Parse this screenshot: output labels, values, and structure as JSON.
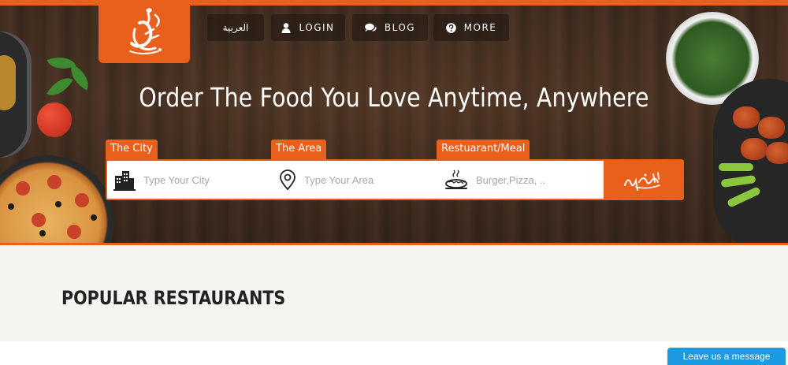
{
  "logo": {
    "alt": "brand-logo"
  },
  "nav": {
    "arabic_label": "العربية",
    "login_label": "LOGIN",
    "blog_label": "BLOG",
    "more_label": "MORE"
  },
  "hero": {
    "title": "Order The Food You Love Anytime, Anywhere"
  },
  "search": {
    "city_label": "The City",
    "city_placeholder": "Type Your City",
    "area_label": "The Area",
    "area_placeholder": "Type Your Area",
    "meal_label": "Restuarant/Meal",
    "meal_placeholder": "Burger,Pizza, ..",
    "button_icon": "arabic-calligraphy-search-icon"
  },
  "popular": {
    "title": "POPULAR RESTAURANTS"
  },
  "chat": {
    "label": "Leave us a message"
  },
  "colors": {
    "accent": "#e8601c",
    "chat": "#1d9be0",
    "hero_wood": "#4a3424"
  }
}
